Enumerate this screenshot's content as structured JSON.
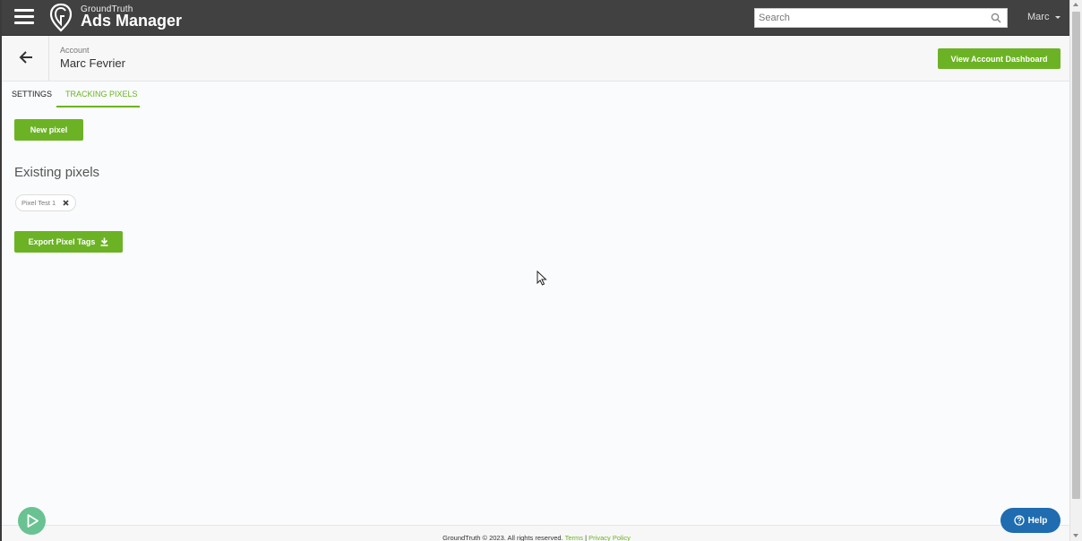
{
  "header": {
    "brand_small": "GroundTruth",
    "brand_title": "Ads Manager",
    "search_placeholder": "Search",
    "user_name": "Marc"
  },
  "account": {
    "label": "Account",
    "name": "Marc Fevrier",
    "view_dashboard_label": "View Account Dashboard"
  },
  "tabs": [
    {
      "label": "SETTINGS",
      "active": false
    },
    {
      "label": "TRACKING PIXELS",
      "active": true
    }
  ],
  "main": {
    "new_pixel_label": "New pixel",
    "existing_title": "Existing pixels",
    "pixels": [
      {
        "name": "Pixel Test 1"
      }
    ],
    "export_label": "Export Pixel Tags"
  },
  "footer": {
    "copyright": "GroundTruth © 2023. All rights reserved.",
    "terms": "Terms",
    "separator": "|",
    "privacy": "Privacy Policy"
  },
  "help_label": "Help",
  "colors": {
    "accent_green": "#6bb324",
    "topbar": "#414141",
    "help_blue": "#1f6cb0",
    "play_green": "#69c292"
  },
  "icons": [
    "menu-icon",
    "groundtruth-logo-icon",
    "search-icon",
    "chevron-down-icon",
    "back-arrow-icon",
    "close-icon",
    "download-icon",
    "play-icon",
    "help-question-icon",
    "mouse-cursor-icon"
  ]
}
